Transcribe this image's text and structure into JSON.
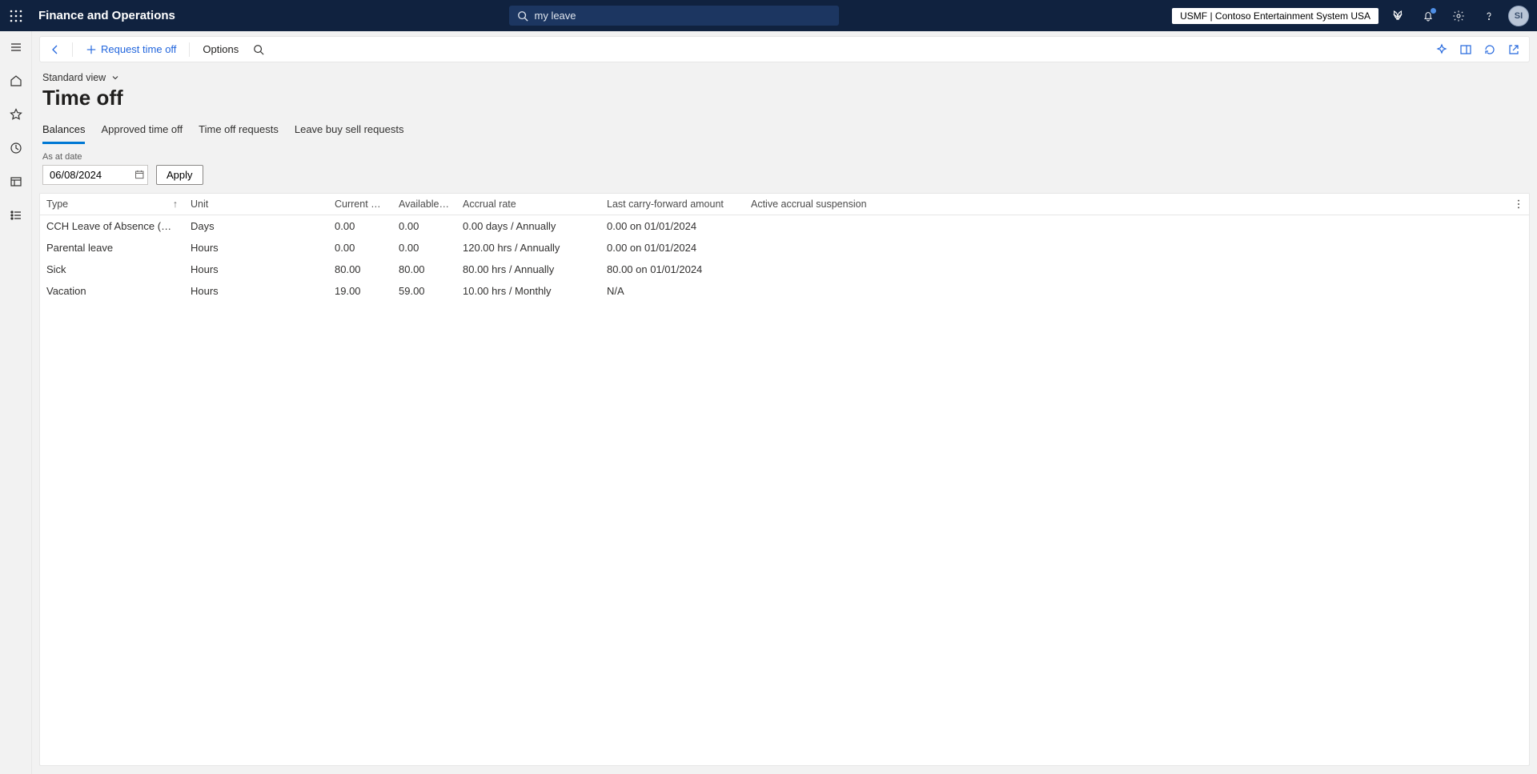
{
  "header": {
    "brand": "Finance and Operations",
    "search_value": "my leave",
    "entity": "USMF | Contoso Entertainment System USA",
    "avatar_initials": "SI"
  },
  "actionbar": {
    "request_label": "Request time off",
    "options_label": "Options"
  },
  "page": {
    "view_label": "Standard view",
    "title": "Time off",
    "tabs": {
      "t0": "Balances",
      "t1": "Approved time off",
      "t2": "Time off requests",
      "t3": "Leave buy sell requests"
    },
    "as_at_label": "As at date",
    "as_at_value": "06/08/2024",
    "apply_label": "Apply"
  },
  "columns": {
    "c0": "Type",
    "c1": "Unit",
    "c2": "Current balance",
    "c3": "Available bala...",
    "c4": "Accrual rate",
    "c5": "Last carry-forward amount",
    "c6": "Active accrual suspension"
  },
  "rows": {
    "r0": {
      "type": "CCH Leave of Absence (Unpaid)",
      "unit": "Days",
      "current": "0.00",
      "available": "0.00",
      "accrual": "0.00 days / Annually",
      "carry": "0.00 on 01/01/2024",
      "suspend": ""
    },
    "r1": {
      "type": "Parental leave",
      "unit": "Hours",
      "current": "0.00",
      "available": "0.00",
      "accrual": "120.00 hrs / Annually",
      "carry": "0.00 on 01/01/2024",
      "suspend": ""
    },
    "r2": {
      "type": "Sick",
      "unit": "Hours",
      "current": "80.00",
      "available": "80.00",
      "accrual": "80.00 hrs / Annually",
      "carry": "80.00 on 01/01/2024",
      "suspend": ""
    },
    "r3": {
      "type": "Vacation",
      "unit": "Hours",
      "current": "19.00",
      "available": "59.00",
      "accrual": "10.00 hrs / Monthly",
      "carry": "N/A",
      "suspend": ""
    }
  }
}
